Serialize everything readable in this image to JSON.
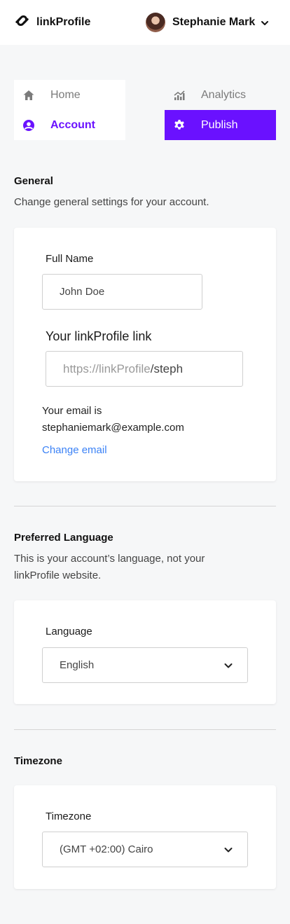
{
  "brand": {
    "name": "linkProfile"
  },
  "user": {
    "name": "Stephanie Mark"
  },
  "nav": {
    "home": "Home",
    "analytics": "Analytics",
    "account": "Account",
    "publish": "Publish"
  },
  "general": {
    "title": "General",
    "description": "Change general settings for your account.",
    "full_name_label": "Full Name",
    "full_name_value": "John Doe",
    "link_label": "Your linkProfile link",
    "link_prefix": "https://linkProfile",
    "link_suffix": "/steph",
    "email_intro": "Your email is",
    "email": "stephaniemark@example.com",
    "change_email": "Change email"
  },
  "language": {
    "title": "Preferred Language",
    "description": "This is your account’s language, not your linkProfile website.",
    "label": "Language",
    "selected": "English"
  },
  "timezone": {
    "title": "Timezone",
    "label": "Timezone",
    "selected": "(GMT +02:00) Cairo"
  },
  "colors": {
    "accent": "#6a11ff",
    "link": "#3b82f6",
    "background": "#f6f7f8"
  },
  "icons": {
    "brand": "linkprofile-logo-icon",
    "user_menu": "chevron-down-icon",
    "home": "home-icon",
    "analytics": "chart-icon",
    "account": "user-circle-icon",
    "publish": "gear-icon",
    "select": "chevron-down-icon"
  }
}
